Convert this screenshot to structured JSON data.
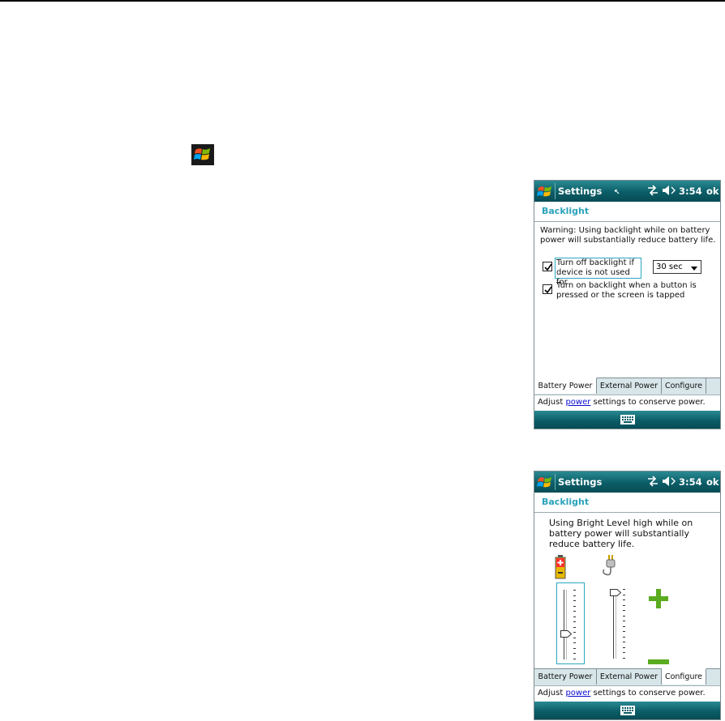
{
  "phone_title": "Settings",
  "time": "3:54",
  "ok_label": "ok",
  "section_heading": "Backlight",
  "tabs": [
    "Battery Power",
    "External Power",
    "Configure"
  ],
  "status": {
    "prefix": "Adjust ",
    "link": "power",
    "suffix": " settings to conserve power."
  },
  "screen1": {
    "warning_line1": "Warning: Using backlight while on battery",
    "warning_line2": "power will substantially reduce battery life.",
    "check1_line1": "Turn off backlight if",
    "check1_line2": "device is not used for",
    "check1_checked": true,
    "timeout_value": "30 sec",
    "check2_line1": "Turn on backlight when a button is",
    "check2_line2": "pressed or the screen is tapped",
    "check2_checked": true,
    "active_tab": "Battery Power"
  },
  "screen2": {
    "info_line1": "Using Bright Level high while on",
    "info_line2": "battery power will substantially",
    "info_line3": "reduce battery life.",
    "battery_level": 0.35,
    "external_level": 1.0,
    "increase_symbol": "+",
    "active_tab": "Configure"
  },
  "colors": {
    "title_bar": "#0b5d67",
    "heading": "#2ba3bb",
    "plus_minus": "#5aab1e",
    "link": "#0a0ad0"
  }
}
